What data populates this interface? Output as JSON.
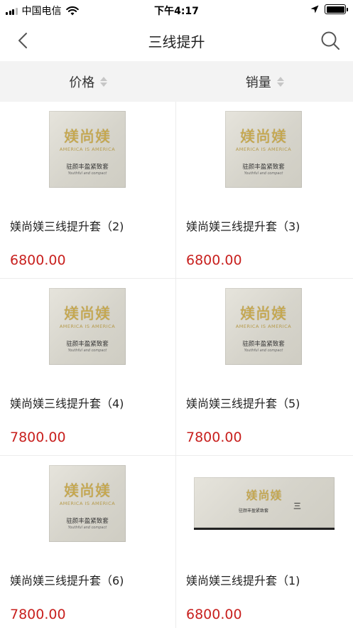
{
  "status_bar": {
    "carrier": "中国电信",
    "time": "下午4:17"
  },
  "nav": {
    "title": "三线提升"
  },
  "sort": {
    "price_label": "价格",
    "sales_label": "销量"
  },
  "products": [
    {
      "title": "媄尚媄三线提升套（2)",
      "price": "6800.00",
      "image": "box"
    },
    {
      "title": "媄尚媄三线提升套（3)",
      "price": "6800.00",
      "image": "box"
    },
    {
      "title": "媄尚媄三线提升套（4)",
      "price": "7800.00",
      "image": "box"
    },
    {
      "title": "媄尚媄三线提升套（5)",
      "price": "7800.00",
      "image": "box"
    },
    {
      "title": "媄尚媄三线提升套（6)",
      "price": "7800.00",
      "image": "box"
    },
    {
      "title": "媄尚媄三线提升套（1)",
      "price": "6800.00",
      "image": "wide-box"
    }
  ],
  "colors": {
    "price": "#c8201e",
    "sort_bar_bg": "#f3f3f3"
  },
  "icons": {
    "back": "chevron-left-icon",
    "search": "search-icon",
    "location": "location-arrow-icon",
    "wifi": "wifi-icon",
    "battery": "battery-icon"
  }
}
